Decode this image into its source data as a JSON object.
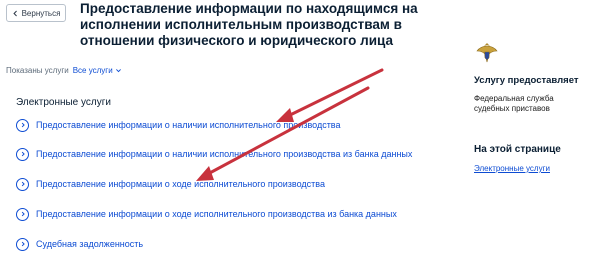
{
  "header": {
    "back_label": "Вернуться",
    "title": "Предоставление информации по находящимся на исполнении исполнительным производствам в отношении физического и юридического лица"
  },
  "filter": {
    "label": "Показаны услуги",
    "selected": "Все услуги"
  },
  "section_title": "Электронные услуги",
  "services": [
    "Предоставление информации о наличии исполнительного производства",
    "Предоставление информации о наличии исполнительного производства из банка данных",
    "Предоставление информации о ходе исполнительного производства",
    "Предоставление информации о ходе исполнительного производства из банка данных",
    "Судебная задолженность"
  ],
  "sidebar": {
    "provider_heading": "Услугу предоставляет",
    "provider_name": "Федеральная служба судебных приставов",
    "on_page_heading": "На этой странице",
    "on_page_link": "Электронные услуги"
  },
  "icons": {
    "back": "chevron-left-icon",
    "filter": "chevron-down-icon",
    "service": "chevron-right-circle-icon",
    "emblem": "fssp-emblem-icon"
  },
  "colors": {
    "link": "#0d4cd3",
    "annotation_arrow": "#c8323d"
  }
}
